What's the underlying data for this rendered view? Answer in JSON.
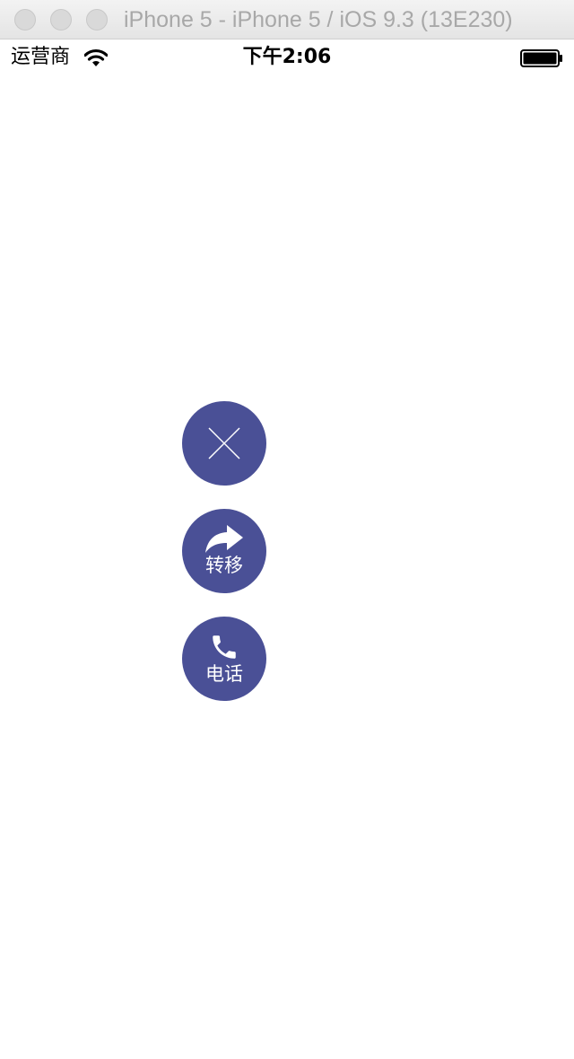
{
  "window": {
    "title": "iPhone 5 - iPhone 5 / iOS 9.3 (13E230)"
  },
  "status_bar": {
    "carrier": "运营商",
    "time": "下午2:06",
    "wifi_icon": "wifi-icon",
    "battery_icon": "battery-icon"
  },
  "actions": {
    "close": {
      "icon": "close-icon"
    },
    "transfer": {
      "icon": "share-arrow-icon",
      "label": "转移"
    },
    "phone": {
      "icon": "phone-icon",
      "label": "电话"
    }
  },
  "colors": {
    "button_background": "#4a5096",
    "button_foreground": "#ffffff",
    "page_background": "#ffffff"
  }
}
